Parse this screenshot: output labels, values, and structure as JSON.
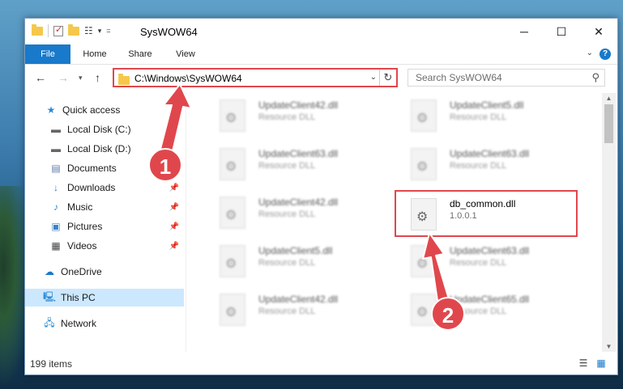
{
  "window": {
    "title": "SysWOW64"
  },
  "ribbon": {
    "tabs": [
      "File",
      "Home",
      "Share",
      "View"
    ],
    "help": "?"
  },
  "window_buttons": [
    "─",
    "☐",
    "✕"
  ],
  "nav": {
    "address": "C:\\Windows\\SysWOW64",
    "search_placeholder": "Search SysWOW64"
  },
  "sidebar": {
    "items": [
      {
        "label": "Quick access",
        "icon": "star-icon",
        "glyph": "★",
        "color": "#2d8bd3",
        "pinned": false
      },
      {
        "label": "Local Disk (C:)",
        "icon": "drive-icon",
        "glyph": "▬",
        "color": "#666666",
        "pinned": false
      },
      {
        "label": "Local Disk (D:)",
        "icon": "drive-icon",
        "glyph": "▬",
        "color": "#666666",
        "pinned": false
      },
      {
        "label": "Documents",
        "icon": "document-icon",
        "glyph": "▤",
        "color": "#5b7aa8",
        "pinned": false
      },
      {
        "label": "Downloads",
        "icon": "download-icon",
        "glyph": "↓",
        "color": "#2d7fd3",
        "pinned": true
      },
      {
        "label": "Music",
        "icon": "music-icon",
        "glyph": "♪",
        "color": "#2d8bd3",
        "pinned": true
      },
      {
        "label": "Pictures",
        "icon": "pictures-icon",
        "glyph": "▣",
        "color": "#3c82c8",
        "pinned": true
      },
      {
        "label": "Videos",
        "icon": "video-icon",
        "glyph": "▦",
        "color": "#444444",
        "pinned": true
      },
      {
        "label": "OneDrive",
        "icon": "cloud-icon",
        "glyph": "☁",
        "color": "#1979ca",
        "pinned": false
      },
      {
        "label": "This PC",
        "icon": "computer-icon",
        "glyph": "🖳",
        "color": "#2d8bd3",
        "pinned": false,
        "selected": true
      },
      {
        "label": "Network",
        "icon": "network-icon",
        "glyph": "🖧",
        "color": "#2d8bd3",
        "pinned": false
      }
    ],
    "pin_glyph": "📌"
  },
  "files": [
    {
      "name": "UpdateClient42.dll",
      "desc": "Resource DLL"
    },
    {
      "name": "UpdateClient5.dll",
      "desc": "Resource DLL"
    },
    {
      "name": "UpdateClient63.dll",
      "desc": "Resource DLL"
    },
    {
      "name": "UpdateClient63.dll",
      "desc": "Resource DLL"
    },
    {
      "name": "UpdateClient42.dll",
      "desc": "Resource DLL"
    },
    {
      "name": "db_common.dll",
      "desc": "1.0.0.1",
      "highlighted": true
    },
    {
      "name": "UpdateClient5.dll",
      "desc": "Resource DLL"
    },
    {
      "name": "UpdateClient63.dll",
      "desc": "Resource DLL"
    },
    {
      "name": "UpdateClient42.dll",
      "desc": "Resource DLL"
    },
    {
      "name": "UpdateClient65.dll",
      "desc": "Resource DLL"
    }
  ],
  "status": {
    "count": "199 items"
  },
  "annotations": {
    "step1": "1",
    "step2": "2",
    "color": "#e0474c"
  }
}
